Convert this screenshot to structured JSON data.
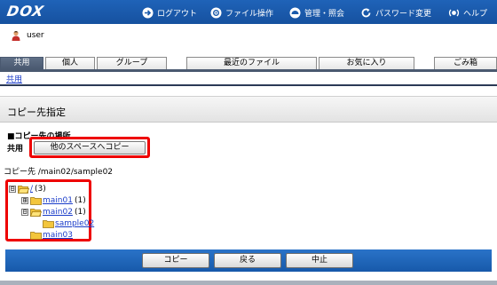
{
  "header": {
    "logo": "DOX",
    "nav": [
      {
        "label": "ログアウト",
        "icon": "logout-icon"
      },
      {
        "label": "ファイル操作",
        "icon": "gear-icon"
      },
      {
        "label": "管理・照会",
        "icon": "admin-icon"
      },
      {
        "label": "パスワード変更",
        "icon": "refresh-icon"
      },
      {
        "label": "ヘルプ",
        "icon": "help-icon"
      }
    ],
    "background_color": "#1a5aab"
  },
  "user": {
    "name": "user",
    "icon": "user-icon"
  },
  "tabs": [
    "共用",
    "個人",
    "グループ",
    "最近のファイル",
    "お気に入り",
    "ごみ箱"
  ],
  "active_tab": "共用",
  "breadcrumb": "共用",
  "section_title": "コピー先指定",
  "location": {
    "title": "■コピー先の場所",
    "label": "共用",
    "button": "他のスペースへコピー"
  },
  "destination": "コピー先 /main02/sample02",
  "tree": {
    "root": {
      "label": "/",
      "count": "(3)",
      "toggle": "⊟"
    },
    "nodes": [
      {
        "label": "main01",
        "count": "(1)",
        "toggle": "⊞"
      },
      {
        "label": "main02",
        "count": "(1)",
        "toggle": "⊟"
      },
      {
        "label": "sample02",
        "count": ""
      },
      {
        "label": "main03",
        "count": ""
      }
    ]
  },
  "actions": {
    "copy": "コピー",
    "back": "戻る",
    "cancel": "中止"
  },
  "colors": {
    "accent_blue": "#1f63b8",
    "highlight_red": "#e00000",
    "link": "#1a3cc9",
    "tab_active": "#4a5970"
  }
}
